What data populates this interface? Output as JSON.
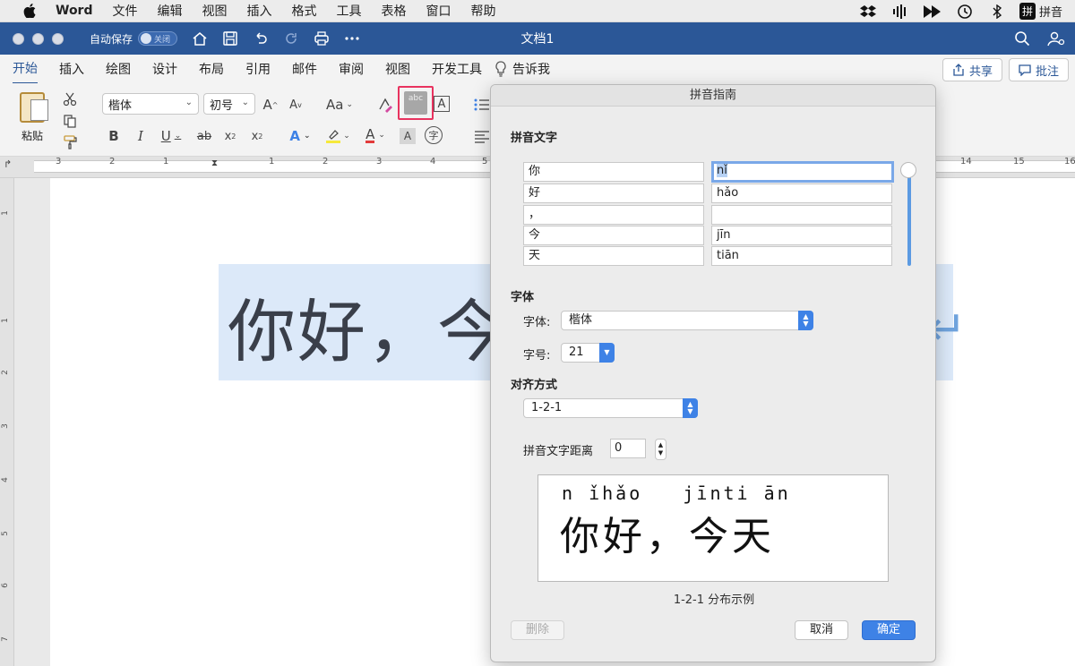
{
  "menubar": {
    "app_name": "Word",
    "items": [
      "文件",
      "编辑",
      "视图",
      "插入",
      "格式",
      "工具",
      "表格",
      "窗口",
      "帮助"
    ],
    "ime_label": "拼音",
    "ime_box": "拼"
  },
  "titlebar": {
    "autosave_label": "自动保存",
    "autosave_state": "关闭",
    "doc_title": "文档1"
  },
  "ribbon": {
    "tabs": [
      "开始",
      "插入",
      "绘图",
      "设计",
      "布局",
      "引用",
      "邮件",
      "审阅",
      "视图",
      "开发工具"
    ],
    "tell_me": "告诉我",
    "share": "共享",
    "comments": "批注",
    "paste": "粘贴",
    "font_name": "楷体",
    "font_size": "初号"
  },
  "ruler": {
    "h_numbers": [
      "3",
      "2",
      "1",
      "1",
      "2",
      "3",
      "4",
      "5",
      "14",
      "15",
      "16"
    ],
    "v_numbers": [
      "1",
      "1",
      "2",
      "3",
      "4",
      "5",
      "6",
      "7"
    ]
  },
  "document": {
    "visible_text": "你好，今"
  },
  "dialog": {
    "title": "拼音指南",
    "section_base_text": "拼音文字",
    "rows": [
      {
        "base": "你",
        "ruby": "nǐ"
      },
      {
        "base": "好",
        "ruby": "hǎo"
      },
      {
        "base": "，",
        "ruby": ""
      },
      {
        "base": "今",
        "ruby": "jīn"
      },
      {
        "base": "天",
        "ruby": "tiān"
      }
    ],
    "section_font": "字体",
    "font_label": "字体:",
    "font_value": "楷体",
    "size_label": "字号:",
    "size_value": "21",
    "section_align": "对齐方式",
    "align_value": "1-2-1",
    "offset_label": "拼音文字距离",
    "offset_value": "0",
    "preview_pinyin": "n ǐhǎo   jīnti ān",
    "preview_hanzi": "你好，今天",
    "caption": "1-2-1 分布示例",
    "delete": "删除",
    "cancel": "取消",
    "ok": "确定"
  }
}
